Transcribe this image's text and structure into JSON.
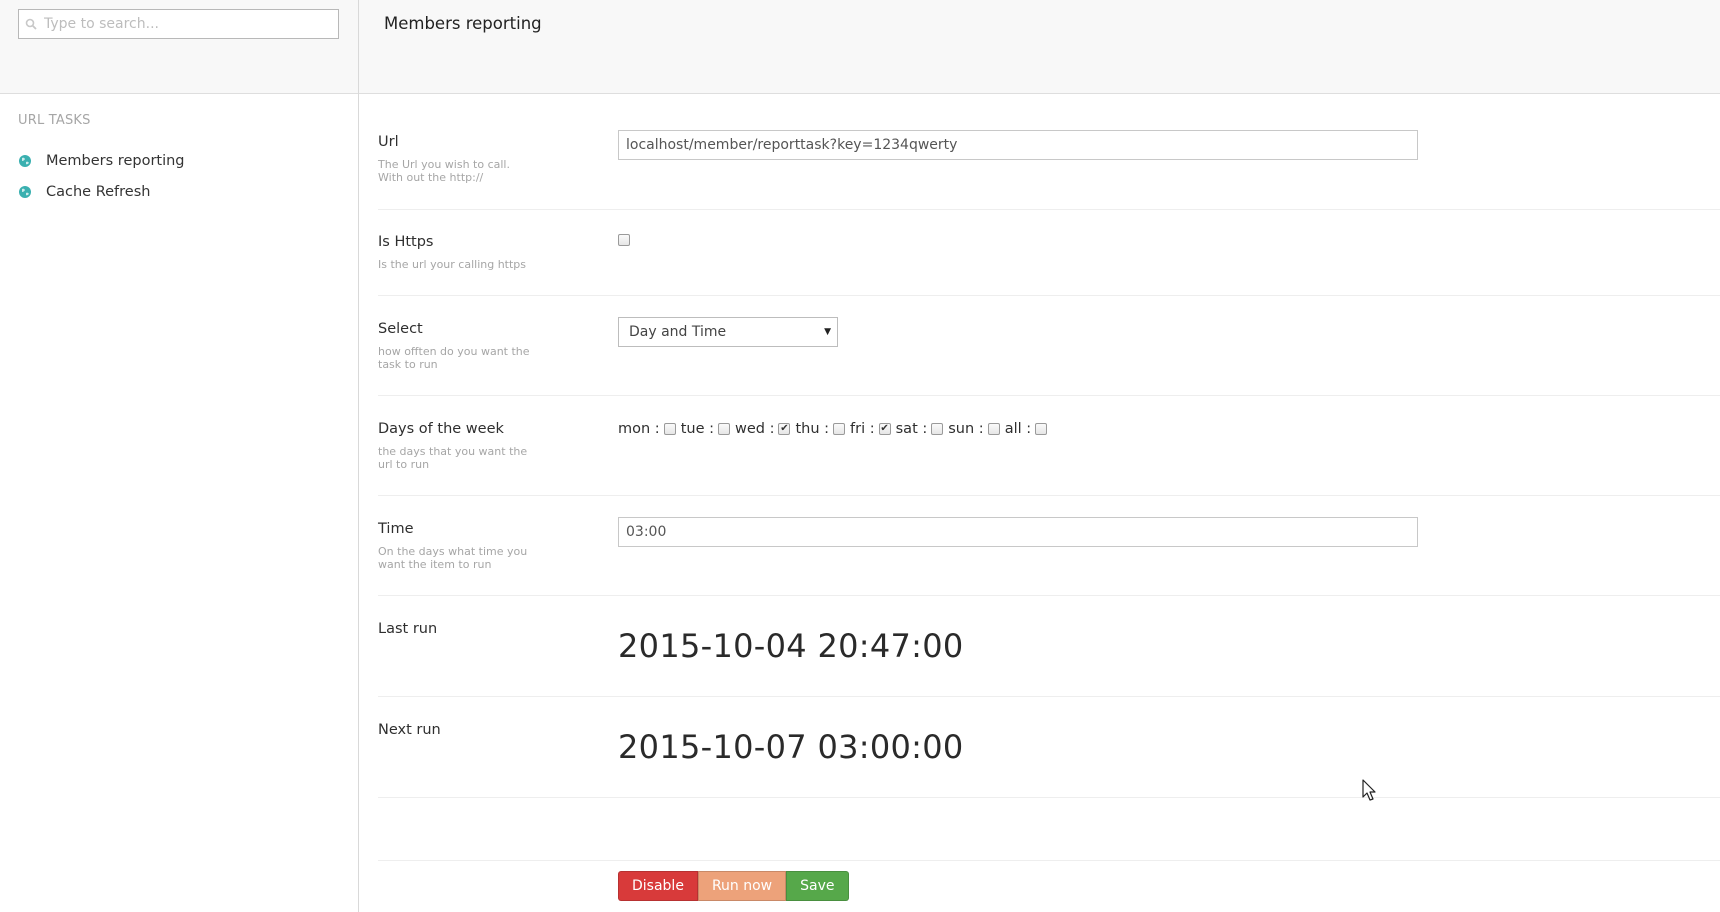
{
  "search": {
    "placeholder": "Type to search..."
  },
  "sidebar": {
    "heading": "URL TASKS",
    "items": [
      {
        "label": "Members reporting",
        "icon": "globe-icon"
      },
      {
        "label": "Cache Refresh",
        "icon": "globe-icon"
      }
    ]
  },
  "page": {
    "title": "Members reporting"
  },
  "form": {
    "url": {
      "label": "Url",
      "description": "The Url you wish to call. With out the http://",
      "value": "localhost/member/reporttask?key=1234qwerty"
    },
    "is_https": {
      "label": "Is Https",
      "description": "Is the url your calling https",
      "checked": false
    },
    "select": {
      "label": "Select",
      "description": "how offten do you want the task to run",
      "value": "Day and Time"
    },
    "days": {
      "label": "Days of the week",
      "description": "the days that you want the url to run",
      "items": [
        {
          "label": "mon :",
          "checked": false
        },
        {
          "label": "tue :",
          "checked": false
        },
        {
          "label": "wed :",
          "checked": true
        },
        {
          "label": "thu :",
          "checked": false
        },
        {
          "label": "fri :",
          "checked": true
        },
        {
          "label": "sat :",
          "checked": false
        },
        {
          "label": "sun :",
          "checked": false
        },
        {
          "label": "all :",
          "checked": false
        }
      ]
    },
    "time": {
      "label": "Time",
      "description": "On the days what time you want the item to run",
      "value": "03:00"
    },
    "last_run": {
      "label": "Last run",
      "value": "2015-10-04 20:47:00"
    },
    "next_run": {
      "label": "Next run",
      "value": "2015-10-07 03:00:00"
    }
  },
  "buttons": {
    "disable": "Disable",
    "run_now": "Run now",
    "save": "Save"
  },
  "colors": {
    "disable": "#d83a3a",
    "run_now": "#eda27a",
    "save": "#56a84a",
    "globe": "#3ab0b0"
  }
}
